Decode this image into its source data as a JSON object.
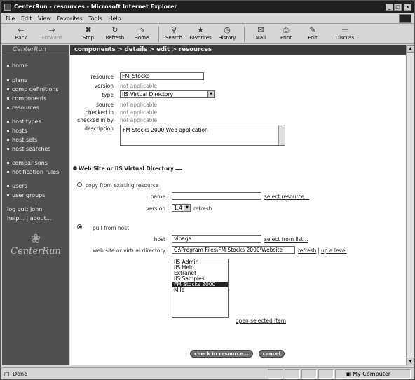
{
  "window": {
    "title": "CenterRun - resources - Microsoft Internet Explorer",
    "minimize": "_",
    "maximize": "□",
    "close": "x"
  },
  "menu": [
    "File",
    "Edit",
    "View",
    "Favorites",
    "Tools",
    "Help"
  ],
  "toolbar": [
    {
      "label": "Back",
      "icon": "back-arrow-icon"
    },
    {
      "label": "Forward",
      "icon": "forward-arrow-icon"
    },
    {
      "label": "Stop",
      "icon": "stop-icon"
    },
    {
      "label": "Refresh",
      "icon": "refresh-icon"
    },
    {
      "label": "Home",
      "icon": "home-icon"
    },
    {
      "label": "Search",
      "icon": "search-icon"
    },
    {
      "label": "Favorites",
      "icon": "favorites-icon"
    },
    {
      "label": "History",
      "icon": "history-icon"
    },
    {
      "label": "Mail",
      "icon": "mail-icon"
    },
    {
      "label": "Print",
      "icon": "print-icon"
    },
    {
      "label": "Edit",
      "icon": "edit-icon"
    },
    {
      "label": "Discuss",
      "icon": "discuss-icon"
    }
  ],
  "sidebar": {
    "brand": "CenterRun",
    "group1": [
      "home"
    ],
    "group2": [
      "plans",
      "comp definitions",
      "components",
      "resources"
    ],
    "group3": [
      "host types",
      "hosts",
      "host sets",
      "host searches"
    ],
    "group4": [
      "comparisons",
      "notification rules"
    ],
    "group5": [
      "users",
      "user groups"
    ],
    "logout": "log out: john",
    "help": "help... | about...",
    "logo_text": "CenterRun"
  },
  "breadcrumb": "components > details > edit > resources",
  "form": {
    "resource_label": "resource",
    "resource_value": "FM_Stocks",
    "version_label": "version",
    "version_value": "not applicable",
    "type_label": "type",
    "type_value": "IIS Virtual Directory",
    "source_label": "source",
    "source_value": "not applicable",
    "checkedin_label": "checked in",
    "checkedin_value": "not applicable",
    "checkedinby_label": "checked in by",
    "checkedinby_value": "not applicable",
    "description_label": "description",
    "description_value": "FM Stocks 2000 Web application"
  },
  "section": {
    "title": "Web Site or IIS Virtual Directory",
    "copy_label": "copy from existing resource",
    "name_label": "name",
    "name_value": "",
    "select_resource_link": "select resource...",
    "version_label": "version",
    "version_value": "1.4",
    "refresh_label": "refresh",
    "pull_label": "pull from host",
    "host_label": "host",
    "host_value": "vinaga",
    "select_from_list_link": "select from list...",
    "vdir_label": "web site or virtual directory",
    "vdir_value": "C:\\Program Files\\FM Stocks 2000\\Website",
    "refresh_link": "refresh",
    "up_level_link": "up a level",
    "list_items": [
      "IIS Admin",
      "IIS Help",
      "Extranet",
      "IIS Samples",
      "FM Stocks 2000",
      "Mile"
    ],
    "selected_item": "FM Stocks 2000",
    "open_item_link": "open selected item"
  },
  "buttons": {
    "check_in": "check in resource...",
    "cancel": "cancel"
  },
  "status": {
    "left": "Done",
    "zone": "My Computer"
  }
}
